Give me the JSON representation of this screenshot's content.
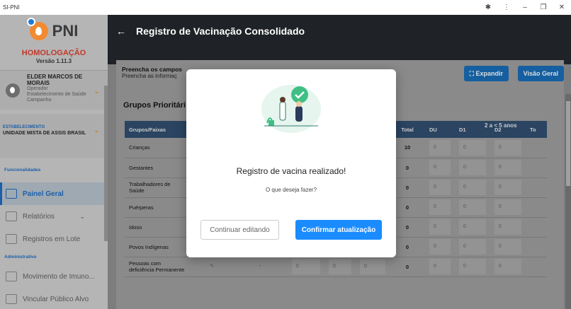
{
  "window": {
    "title": "SI-PNI",
    "controls": [
      "pin-icon",
      "more-icon",
      "minimize-icon",
      "maximize-icon",
      "close-icon"
    ]
  },
  "sidebar": {
    "logo": "PNI",
    "environment": "HOMOLOGAÇÃO",
    "version": "Versão 1.11.3",
    "user": {
      "name": "ELDER MARCOS DE MORAIS",
      "role": "Operador",
      "place": "Estabelecimento de Saúde Campanha"
    },
    "establishment": {
      "label": "ESTABELECIMENTO",
      "value": "UNIDADE MISTA DE ASSIS BRASIL"
    },
    "section_func": "Funcionalidades",
    "items": [
      {
        "label": "Painel Geral",
        "icon": "dashboard-icon"
      },
      {
        "label": "Relatórios",
        "icon": "reports-icon"
      },
      {
        "label": "Registros em Lote",
        "icon": "batch-icon"
      }
    ],
    "section_admin": "Administrativo",
    "admin_items": [
      {
        "label": "Movimento de Imuno...",
        "icon": "movement-icon"
      },
      {
        "label": "Vincular Público Alvo",
        "icon": "link-icon"
      }
    ]
  },
  "header": {
    "title": "Registro de Vacinação Consolidado"
  },
  "info": {
    "line1": "Preencha os campos",
    "line2": "Preencha as informaç",
    "expand": "Expandir",
    "overview": "Visão Geral"
  },
  "groups": {
    "title": "Grupos Prioritári",
    "header_group": "Grupos/Faixas",
    "age_range": "2 a < 5 anos",
    "cols": [
      "Total",
      "DU",
      "D1",
      "D2",
      "To"
    ],
    "rows": [
      {
        "name": "Crianças",
        "total": "10"
      },
      {
        "name": "Gestantes",
        "total": "0"
      },
      {
        "name": "Trabalhadores de Saúde",
        "total": "0"
      },
      {
        "name": "Puérperas",
        "total": "0"
      },
      {
        "name": "Idoso",
        "total": "0"
      },
      {
        "name": "Povos Indígenas",
        "total": "0"
      },
      {
        "name": "Pessoas com deficiência Permanente",
        "total": "0"
      }
    ],
    "dash": "-",
    "zero": "0"
  },
  "modal": {
    "title": "Registro de vacina realizado!",
    "question": "O que deseja fazer?",
    "continue": "Continuar editando",
    "confirm": "Confirmar atualização"
  }
}
